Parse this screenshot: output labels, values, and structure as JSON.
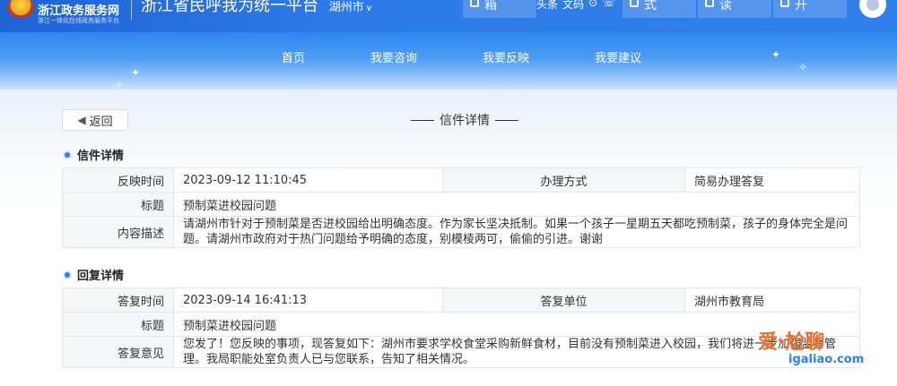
{
  "header": {
    "logo_title": "浙江政务服务网",
    "logo_sub": "浙江一体化在线政务服务平台",
    "site_title": "浙江省民呼我为统一平台",
    "site_city": "湖州市",
    "tools": [
      {
        "label": "箱"
      },
      {
        "label": "式"
      },
      {
        "label": "读"
      },
      {
        "label": "开"
      }
    ],
    "utils": [
      "头条",
      "文码",
      "⊙",
      "☏"
    ]
  },
  "nav": {
    "items": [
      "首页",
      "我要咨询",
      "我要反映",
      "我要建议"
    ]
  },
  "page": {
    "back_label": "返回",
    "title": "信件详情"
  },
  "letter": {
    "section_title": "信件详情",
    "rows": {
      "time_label": "反映时间",
      "time_value": "2023-09-12 11:10:45",
      "method_label": "办理方式",
      "method_value": "简易办理答复",
      "subject_label": "标题",
      "subject_value": "预制菜进校园问题",
      "content_label": "内容描述",
      "content_value": "请湖州市针对于预制菜是否进校园给出明确态度。作为家长坚决抵制。如果一个孩子一星期五天都吃预制菜，孩子的身体完全是问题。请湖州市政府对于热门问题给予明确的态度，别模棱两可，偷偷的引进。谢谢"
    }
  },
  "reply": {
    "section_title": "回复详情",
    "rows": {
      "time_label": "答复时间",
      "time_value": "2023-09-14 16:41:13",
      "unit_label": "答复单位",
      "unit_value": "湖州市教育局",
      "subject_label": "标题",
      "subject_value": "预制菜进校园问题",
      "opinion_label": "答复意见",
      "opinion_value": "您发了！您反映的事项，现答复如下：湖州市要求学校食堂采购新鲜食材，目前没有预制菜进入校园，我们将进一步加强监督管理。我局职能处室负责人已与您联系，告知了相关情况。"
    }
  },
  "watermark": {
    "text": "爱·尬聊",
    "sub": "igaliao.com"
  },
  "colors": {
    "primary": "#2f80ea",
    "label_bg": "#f5f6f8",
    "border": "#e3e7ec",
    "watermark": "#e8712f"
  }
}
